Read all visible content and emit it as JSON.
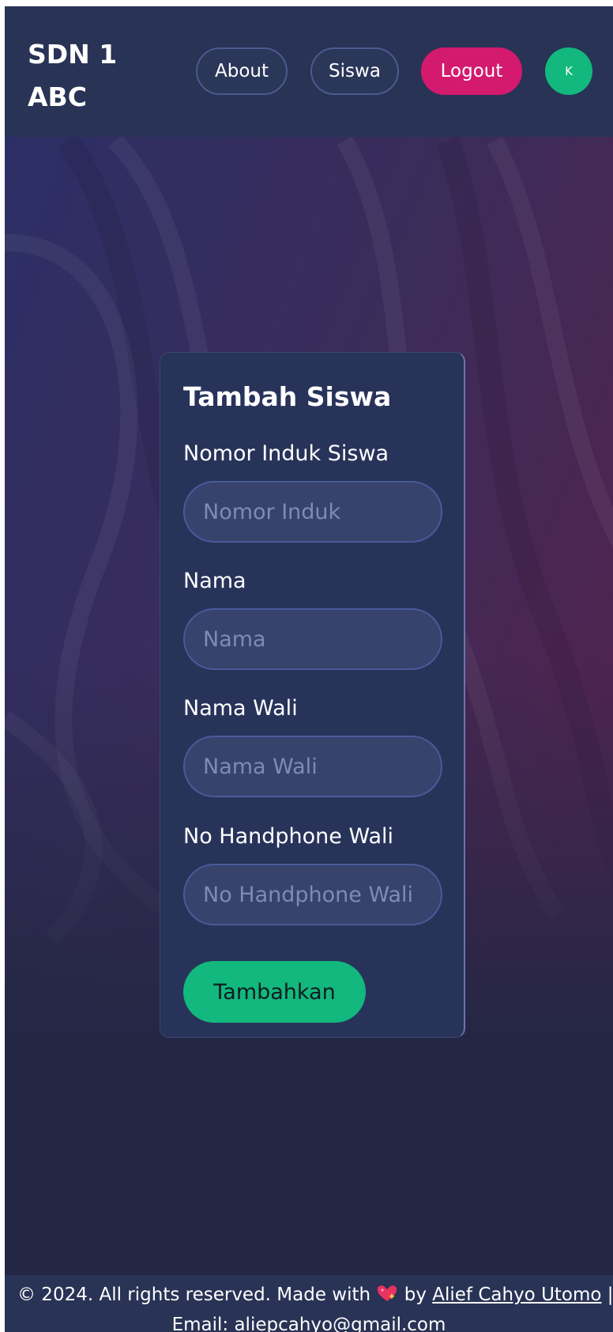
{
  "header": {
    "brand": "SDN 1 ABC",
    "nav": {
      "about_label": "About",
      "siswa_label": "Siswa",
      "logout_label": "Logout"
    },
    "avatar_initial": "K"
  },
  "form": {
    "title": "Tambah Siswa",
    "fields": [
      {
        "label": "Nomor Induk Siswa",
        "placeholder": "Nomor Induk",
        "value": ""
      },
      {
        "label": "Nama",
        "placeholder": "Nama",
        "value": ""
      },
      {
        "label": "Nama Wali",
        "placeholder": "Nama Wali",
        "value": ""
      },
      {
        "label": "No Handphone Wali",
        "placeholder": "No Handphone Wali",
        "value": ""
      }
    ],
    "submit_label": "Tambahkan"
  },
  "footer": {
    "prefix": "© 2024. All rights reserved. Made with",
    "by": "by",
    "author": "Alief Cahyo Utomo",
    "separator": "|",
    "email_line": "Email: aliepcahyo@gmail.com"
  },
  "colors": {
    "background": "#232744",
    "navbar": "#283355",
    "card": "#28335a",
    "input": "#37426d",
    "logout": "#d31a6f",
    "accent_green": "#12b87d"
  },
  "icons": {
    "footer_heart": "sparkling-heart-icon"
  }
}
